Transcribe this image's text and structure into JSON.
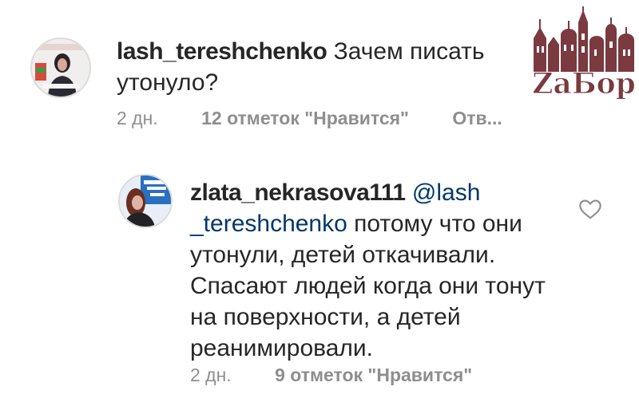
{
  "comments": [
    {
      "username": "lash_tereshchenko",
      "text": "Зачем писать утонуло?",
      "time": "2 дн.",
      "likes": "12 отметок \"Нравится\"",
      "reply": "Отв..."
    },
    {
      "username": "zlata_nekrasova111",
      "mention": "@lash _tereshchenko",
      "text": "потому что они утонули, детей откачивали. Спасают людей когда они тонут на поверхности, а детей реанимировали.",
      "time": "2 дн.",
      "likes": "9 отметок \"Нравится\""
    }
  ],
  "watermark": {
    "text": "ZaБор"
  },
  "icons": {
    "like": "heart-icon"
  },
  "colors": {
    "text": "#262626",
    "meta": "#8e8e8e",
    "mention": "#00376b",
    "logo": "#7a3a40"
  }
}
